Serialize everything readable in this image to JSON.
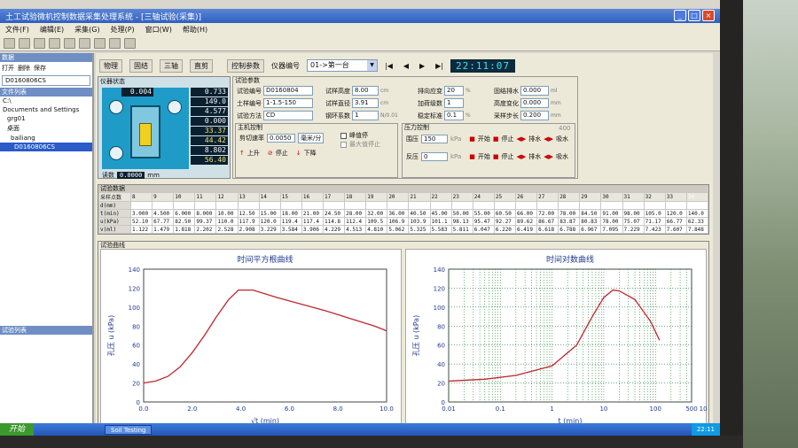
{
  "window": {
    "title": "土工试验微机控制数据采集处理系统 - [三轴试验(采集)]",
    "buttons": [
      "_",
      "□",
      "×"
    ]
  },
  "menu": [
    "文件(F)",
    "编辑(E)",
    "采集(G)",
    "处理(P)",
    "窗口(W)",
    "帮助(H)"
  ],
  "left_pane": {
    "header1": "数据",
    "buttons": [
      "打开",
      "删除",
      "保存"
    ],
    "sample_id": "D0160806CS",
    "header2": "文件列表",
    "tree": [
      "C:\\",
      "Documents and Settings",
      "grg01",
      "桌面",
      "bailiang",
      "D0160806CS"
    ],
    "header3": "试验列表"
  },
  "app_toolbar": {
    "tabs": [
      "物理",
      "固结",
      "三轴",
      "直剪"
    ],
    "control_params": "控制参数",
    "instrument_label": "仪器编号",
    "instrument_value": "01->第一台",
    "nav": [
      "|◀",
      "◀",
      "▶",
      "▶|"
    ],
    "clock": "22:11:07"
  },
  "device": {
    "header": "仪器状态",
    "top_value": "0.004",
    "readings": [
      "0.733",
      "149.0",
      "4.577",
      "0.000",
      "33.37",
      "44.42",
      "8.802",
      "56.40"
    ],
    "footer_label": "读数",
    "footer_value": "0.0000",
    "footer_unit": "mm"
  },
  "params": {
    "legend": "试验参数",
    "fields": [
      {
        "label": "试验编号",
        "value": "D0160804"
      },
      {
        "label": "试样高度",
        "value": "8.00",
        "unit": "cm"
      },
      {
        "label": "排向应变",
        "value": "20",
        "unit": "%"
      },
      {
        "label": "固结排水",
        "value": "0.000",
        "unit": "ml"
      },
      {
        "label": "土样编号",
        "value": "1-1.5-150"
      },
      {
        "label": "试样直径",
        "value": "3.91",
        "unit": "cm"
      },
      {
        "label": "加荷级数",
        "value": "1"
      },
      {
        "label": "高度变化",
        "value": "0.000",
        "unit": "mm"
      },
      {
        "label": "试验方法",
        "value": "CD"
      },
      {
        "label": "钢环系数",
        "value": "1",
        "unit": "N/0.01"
      },
      {
        "label": "稳定标准",
        "value": "0.1",
        "unit": "%"
      },
      {
        "label": "采样步长",
        "value": "0.200",
        "unit": "mm"
      }
    ],
    "host_control": "主机控制",
    "shear_rate_label": "剪切速率",
    "shear_rate_value": "0.0050",
    "shear_rate_unit": "毫米/分",
    "peak_stop": "峰值停",
    "max_stop": "最大值停止",
    "up": "上升",
    "stop": "停止",
    "down": "下降",
    "pressure_control": "压力控制",
    "pressure_max": "400",
    "confining_label": "围压",
    "confining_value": "150",
    "back_label": "反压",
    "back_value": "0",
    "kpa": "kPa",
    "start": "开始",
    "stop2": "停止",
    "drain": "排水",
    "suction": "吸水"
  },
  "table": {
    "title": "试验数据",
    "header_label": "采样点数",
    "columns": [
      "8",
      "9",
      "10",
      "11",
      "12",
      "13",
      "14",
      "15",
      "16",
      "17",
      "18",
      "19",
      "20",
      "21",
      "22",
      "23",
      "24",
      "25",
      "26",
      "27",
      "28",
      "29",
      "30",
      "31",
      "32",
      "33",
      "34"
    ],
    "rows": [
      {
        "label": "d(mm)",
        "values": [
          "",
          "",
          "",
          "",
          "",
          "",
          "",
          "",
          "",
          "",
          "",
          "",
          "",
          "",
          "",
          "",
          "",
          "",
          "",
          "",
          "",
          "",
          "",
          "",
          "",
          "",
          ""
        ]
      },
      {
        "label": "t(min)",
        "values": [
          "3.000",
          "4.500",
          "6.000",
          "8.000",
          "10.00",
          "12.50",
          "15.00",
          "18.00",
          "21.00",
          "24.50",
          "28.00",
          "32.00",
          "36.00",
          "40.50",
          "45.00",
          "50.00",
          "55.00",
          "60.50",
          "66.00",
          "72.00",
          "78.00",
          "84.50",
          "91.00",
          "98.00",
          "105.0",
          "120.0",
          "140.0"
        ]
      },
      {
        "label": "u(kPa)",
        "values": [
          "52.10",
          "67.77",
          "82.50",
          "99.37",
          "110.0",
          "117.9",
          "120.0",
          "119.4",
          "117.4",
          "114.8",
          "112.4",
          "109.5",
          "106.9",
          "103.9",
          "101.1",
          "98.13",
          "95.47",
          "92.27",
          "89.62",
          "86.67",
          "83.87",
          "80.83",
          "78.00",
          "75.07",
          "71.17",
          "66.77",
          "62.33"
        ]
      },
      {
        "label": "v(ml)",
        "values": [
          "1.122",
          "1.479",
          "1.818",
          "2.202",
          "2.528",
          "2.908",
          "3.229",
          "3.584",
          "3.906",
          "4.229",
          "4.513",
          "4.810",
          "5.062",
          "5.325",
          "5.583",
          "5.811",
          "6.047",
          "6.220",
          "6.419",
          "6.618",
          "6.788",
          "6.967",
          "7.095",
          "7.229",
          "7.423",
          "7.607",
          "7.848"
        ]
      }
    ]
  },
  "charts_panel": {
    "legend": "试验曲线",
    "chart_data": [
      {
        "type": "line",
        "title": "时间平方根曲线",
        "xlabel": "√t (min)",
        "ylabel": "孔压 u (kPa)",
        "xlim": [
          0,
          10
        ],
        "ylim": [
          0,
          140
        ],
        "xticks": [
          "0.0",
          "2.0",
          "4.0",
          "6.0",
          "8.0",
          "10.0"
        ],
        "yticks": [
          "0",
          "20",
          "40",
          "60",
          "80",
          "100",
          "120",
          "140"
        ],
        "x": [
          0.0,
          0.5,
          1.0,
          1.5,
          2.0,
          2.5,
          3.0,
          3.5,
          3.9,
          4.5,
          5.5,
          6.5,
          7.5,
          8.5,
          9.5,
          10.0
        ],
        "y": [
          20,
          22,
          27,
          37,
          52,
          70,
          90,
          108,
          118,
          118,
          110,
          103,
          96,
          88,
          80,
          75
        ],
        "color": "#c0262f",
        "grid": false
      },
      {
        "type": "line",
        "title": "时间对数曲线",
        "xlabel": "t (min)",
        "ylabel": "孔压 u (kPa)",
        "xscale": "log",
        "xlim": [
          0.01,
          500
        ],
        "ylim": [
          0,
          140
        ],
        "xticks": [
          "0.01",
          "0.1",
          "1",
          "10",
          "100",
          "1000",
          "500"
        ],
        "yticks": [
          "0",
          "20",
          "40",
          "60",
          "80",
          "100",
          "120",
          "140"
        ],
        "x": [
          0.01,
          0.05,
          0.2,
          1,
          3,
          6,
          10,
          15,
          20,
          40,
          80,
          120
        ],
        "y": [
          22,
          24,
          28,
          38,
          60,
          90,
          110,
          118,
          117,
          108,
          85,
          65
        ],
        "color": "#c0262f",
        "grid": true
      }
    ]
  },
  "taskbar": {
    "start": "开始",
    "task": "Soil Testing",
    "time": "22:11"
  }
}
